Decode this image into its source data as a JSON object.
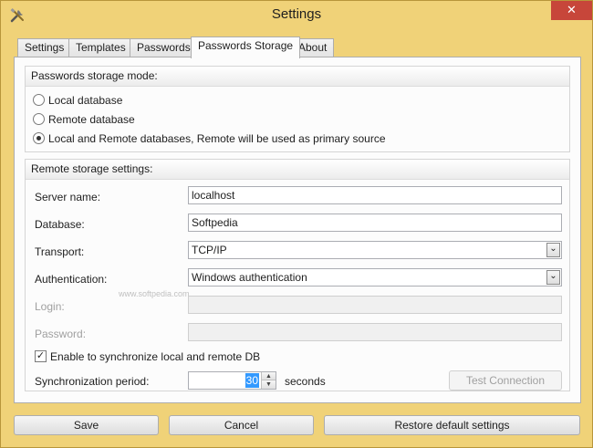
{
  "window": {
    "title": "Settings",
    "close_label": "✕",
    "icon": "tools-icon"
  },
  "tabs": [
    {
      "label": "Settings",
      "active": false
    },
    {
      "label": "Templates",
      "active": false
    },
    {
      "label": "Passwords",
      "active": false
    },
    {
      "label": "Passwords Storage",
      "active": true
    },
    {
      "label": "About",
      "active": false
    }
  ],
  "storage_mode": {
    "title": "Passwords storage mode:",
    "options": [
      {
        "label": "Local database",
        "checked": false
      },
      {
        "label": "Remote database",
        "checked": false
      },
      {
        "label": "Local and Remote databases, Remote will be used as primary source",
        "checked": true
      }
    ]
  },
  "remote": {
    "title": "Remote storage settings:",
    "server_name_label": "Server name:",
    "server_name_value": "localhost",
    "database_label": "Database:",
    "database_value": "Softpedia",
    "transport_label": "Transport:",
    "transport_value": "TCP/IP",
    "authentication_label": "Authentication:",
    "authentication_value": "Windows authentication",
    "login_label": "Login:",
    "login_value": "",
    "password_label": "Password:",
    "password_value": "",
    "sync_label": "Enable to synchronize local and remote DB",
    "sync_checked": true,
    "sync_period_label": "Synchronization period:",
    "sync_period_value": "30",
    "sync_period_unit": "seconds",
    "test_connection_label": "Test Connection"
  },
  "watermark": {
    "text": "www.softpedia.com"
  },
  "footer": {
    "save_label": "Save",
    "cancel_label": "Cancel",
    "restore_label": "Restore default settings"
  },
  "colors": {
    "frame": "#f0d278",
    "close": "#c7463a",
    "selection": "#3399ff"
  }
}
